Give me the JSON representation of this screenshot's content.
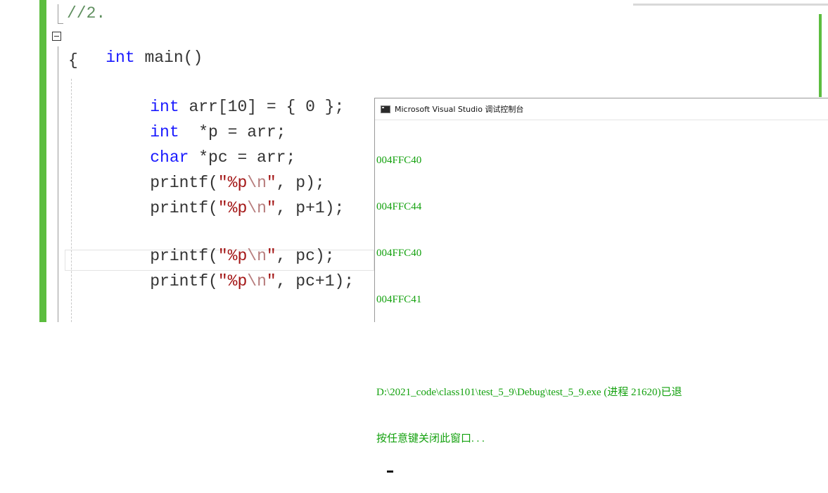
{
  "editor": {
    "lines": {
      "comment": "//2.",
      "main_kw": "int",
      "main_rest": " main()",
      "brace": "{",
      "l1_kw": "int",
      "l1_rest": " arr[10] = { 0 };",
      "l2_kw": "int",
      "l2_rest": "  *p = arr;",
      "l3_kw": "char",
      "l3_rest": " *pc = arr;",
      "l4_fn": "printf(",
      "l4_str_a": "\"%p",
      "l4_esc": "\\n",
      "l4_str_b": "\"",
      "l4_rest": ", p);",
      "l5_fn": "printf(",
      "l5_str_a": "\"%p",
      "l5_esc": "\\n",
      "l5_str_b": "\"",
      "l5_rest": ", p+1);",
      "l6_fn": "printf(",
      "l6_str_a": "\"%p",
      "l6_esc": "\\n",
      "l6_str_b": "\"",
      "l6_rest": ", pc);",
      "l7_fn": "printf(",
      "l7_str_a": "\"%p",
      "l7_esc": "\\n",
      "l7_str_b": "\"",
      "l7_rest": ", pc+1);"
    }
  },
  "console": {
    "title": "Microsoft Visual Studio 调试控制台",
    "output": [
      "004FFC40",
      "004FFC44",
      "004FFC40",
      "004FFC41",
      "",
      "D:\\2021_code\\class101\\test_5_9\\Debug\\test_5_9.exe (进程 21620)已退",
      "按任意键关闭此窗口. . ."
    ]
  },
  "colors": {
    "keyword": "#1a1aff",
    "string": "#a31515",
    "console_text": "#13a10e",
    "change_bar": "#5cbd3f"
  }
}
